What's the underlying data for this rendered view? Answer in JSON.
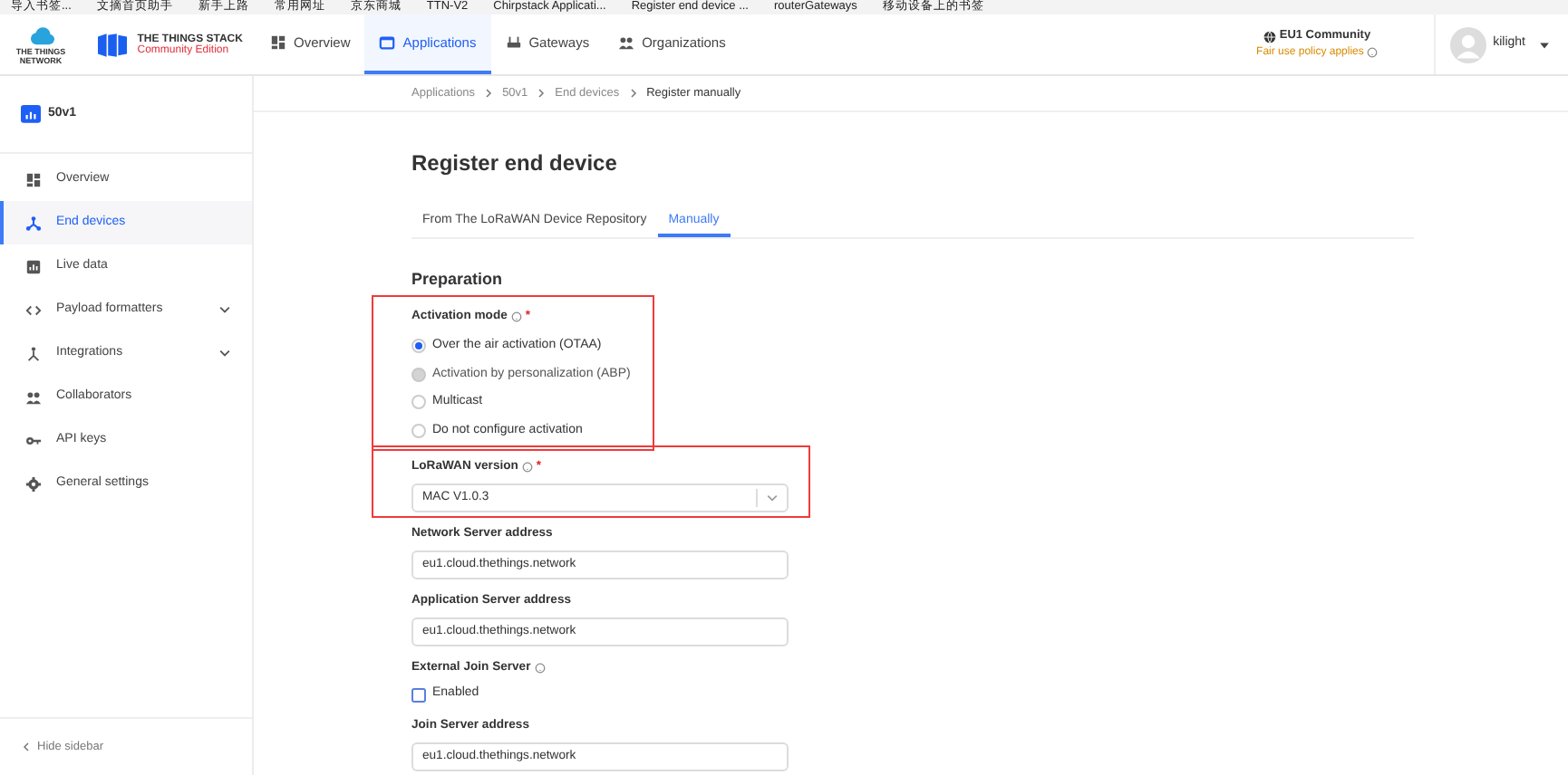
{
  "bookmarks": [
    "导入书签...",
    "文摘首页助手",
    "新手上路",
    "常用网址",
    "京东商城",
    "TTN-V2",
    "Chirpstack Applicati...",
    "Register end device ...",
    "routerGateways",
    "移动设备上的书签"
  ],
  "header": {
    "logo_caption": "THE THINGS NETWORK",
    "brand_title": "THE THINGS STACK",
    "brand_subtitle": "Community Edition",
    "nav": [
      {
        "label": "Overview",
        "selected": false
      },
      {
        "label": "Applications",
        "selected": true
      },
      {
        "label": "Gateways",
        "selected": false
      },
      {
        "label": "Organizations",
        "selected": false
      }
    ],
    "cluster": "EU1 Community",
    "policy": "Fair use policy applies",
    "user": "kilight"
  },
  "sidebar": {
    "app_name": "50v1",
    "items": [
      {
        "label": "Overview",
        "selected": false,
        "expandable": false
      },
      {
        "label": "End devices",
        "selected": true,
        "expandable": false
      },
      {
        "label": "Live data",
        "selected": false,
        "expandable": false
      },
      {
        "label": "Payload formatters",
        "selected": false,
        "expandable": true
      },
      {
        "label": "Integrations",
        "selected": false,
        "expandable": true
      },
      {
        "label": "Collaborators",
        "selected": false,
        "expandable": false
      },
      {
        "label": "API keys",
        "selected": false,
        "expandable": false
      },
      {
        "label": "General settings",
        "selected": false,
        "expandable": false
      }
    ],
    "hide": "Hide sidebar"
  },
  "breadcrumbs": [
    "Applications",
    "50v1",
    "End devices",
    "Register manually"
  ],
  "title": "Register end device",
  "tabs": [
    {
      "label": "From The LoRaWAN Device Repository",
      "selected": false
    },
    {
      "label": "Manually",
      "selected": true
    }
  ],
  "section": "Preparation",
  "fields": [
    {
      "kind": "radio",
      "label": "Activation mode",
      "help": true,
      "required_mark": "*",
      "highlight": true,
      "options": [
        {
          "label": "Over the air activation (OTAA)",
          "selected": true,
          "disabled": false
        },
        {
          "label": "Activation by personalization (ABP)",
          "selected": false,
          "disabled": true
        },
        {
          "label": "Multicast",
          "selected": false,
          "disabled": false
        },
        {
          "label": "Do not configure activation",
          "selected": false,
          "disabled": false
        }
      ]
    },
    {
      "kind": "select",
      "label": "LoRaWAN version",
      "help": true,
      "required_mark": "*",
      "highlight": true,
      "value": "MAC V1.0.3"
    },
    {
      "kind": "input",
      "label": "Network Server address",
      "help": false,
      "highlight": false,
      "value": "eu1.cloud.thethings.network"
    },
    {
      "kind": "input",
      "label": "Application Server address",
      "help": false,
      "highlight": false,
      "value": "eu1.cloud.thethings.network"
    },
    {
      "kind": "checkbox",
      "label": "External Join Server",
      "help": true,
      "highlight": false,
      "text": "Enabled",
      "checked": false
    },
    {
      "kind": "input",
      "label": "Join Server address",
      "help": false,
      "highlight": false,
      "value": "eu1.cloud.thethings.network"
    }
  ]
}
